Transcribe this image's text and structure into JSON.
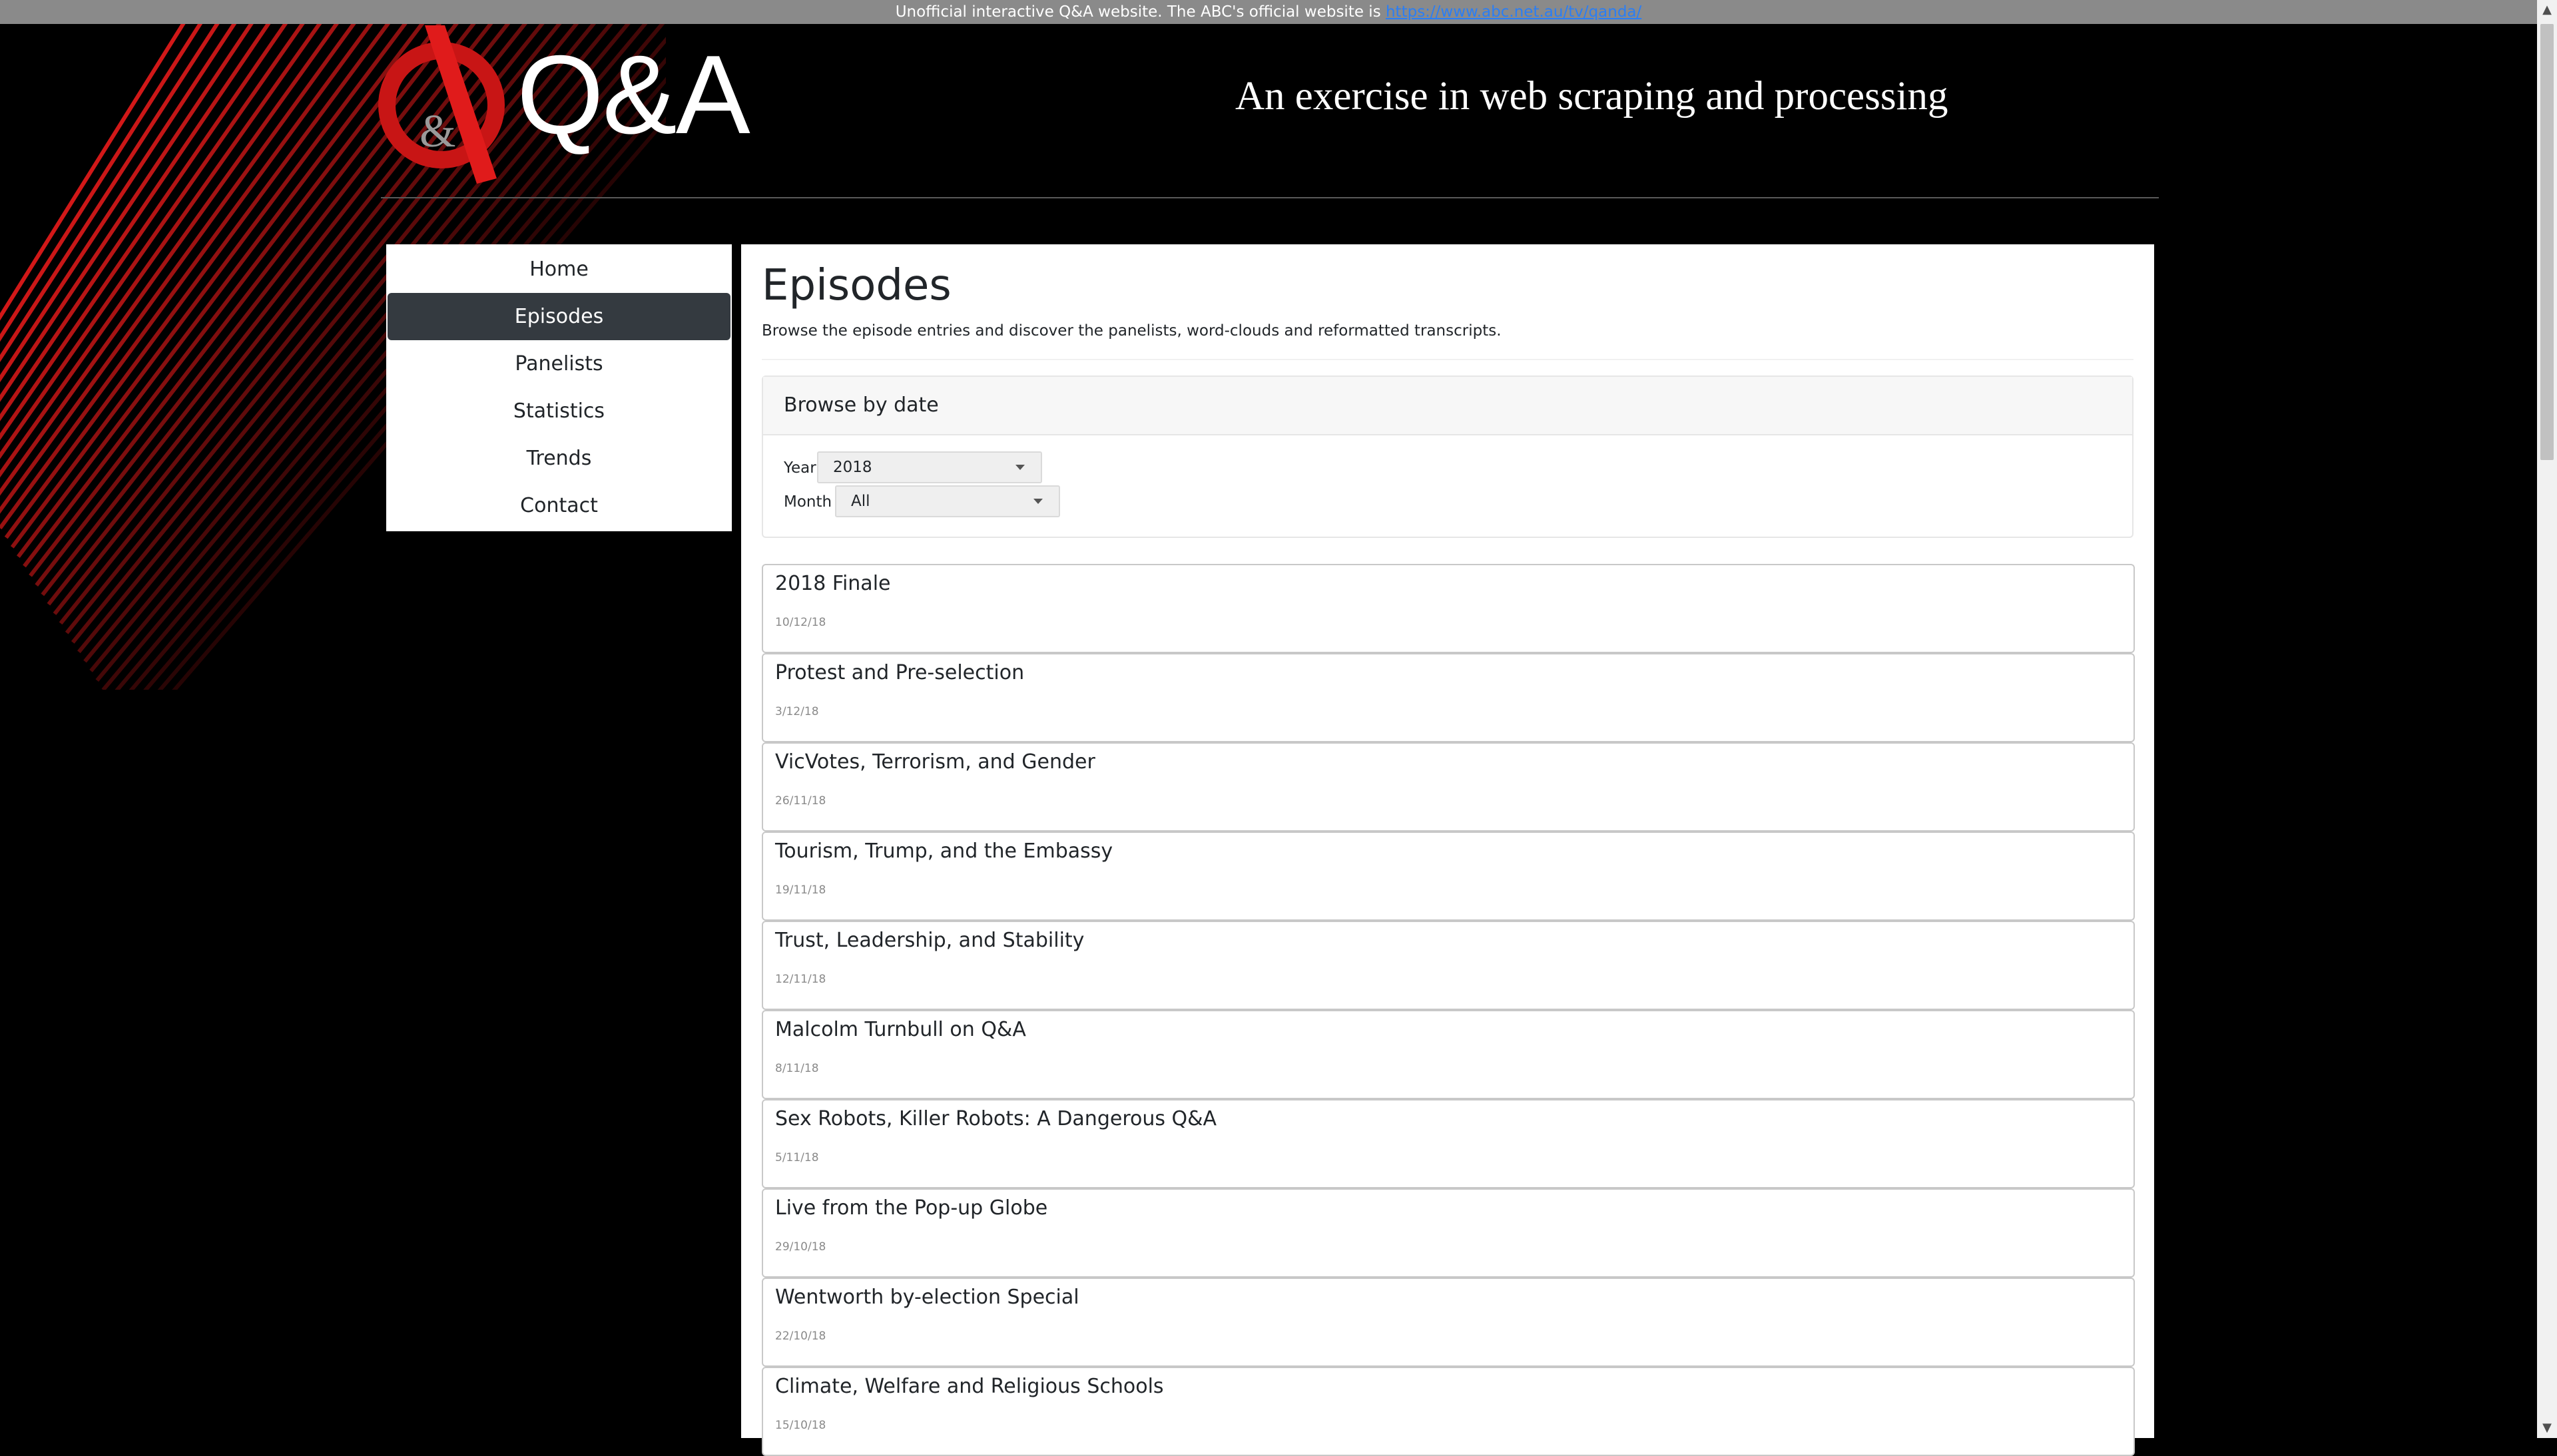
{
  "notice": {
    "text": "Unofficial interactive Q&A website. The ABC's official website is ",
    "link_text": "https://www.abc.net.au/tv/qanda/"
  },
  "header": {
    "logo_text": "Q&A",
    "logo_icon_text": "&",
    "tagline": "An exercise in web scraping and processing"
  },
  "nav": {
    "items": [
      {
        "label": "Home"
      },
      {
        "label": "Episodes"
      },
      {
        "label": "Panelists"
      },
      {
        "label": "Statistics"
      },
      {
        "label": "Trends"
      },
      {
        "label": "Contact"
      }
    ],
    "active": "Episodes"
  },
  "main": {
    "title": "Episodes",
    "lead": "Browse the episode entries and discover the panelists, word-clouds and reformatted transcripts.",
    "filter": {
      "heading": "Browse by date",
      "year_label": "Year",
      "year_value": "2018",
      "month_label": "Month",
      "month_value": "All"
    },
    "episodes": [
      {
        "title": "2018 Finale",
        "date": "10/12/18"
      },
      {
        "title": "Protest and Pre-selection",
        "date": "3/12/18"
      },
      {
        "title": "VicVotes, Terrorism, and Gender",
        "date": "26/11/18"
      },
      {
        "title": "Tourism, Trump, and the Embassy",
        "date": "19/11/18"
      },
      {
        "title": "Trust, Leadership, and Stability",
        "date": "12/11/18"
      },
      {
        "title": "Malcolm Turnbull on Q&A",
        "date": "8/11/18"
      },
      {
        "title": "Sex Robots, Killer Robots: A Dangerous Q&A",
        "date": "5/11/18"
      },
      {
        "title": "Live from the Pop-up Globe",
        "date": "29/10/18"
      },
      {
        "title": "Wentworth by-election Special",
        "date": "22/10/18"
      },
      {
        "title": "Climate, Welfare and Religious Schools",
        "date": "15/10/18"
      }
    ]
  },
  "colors": {
    "accent_red": "#e01b1b",
    "nav_active": "#343a40",
    "link": "#2a7ef5"
  }
}
